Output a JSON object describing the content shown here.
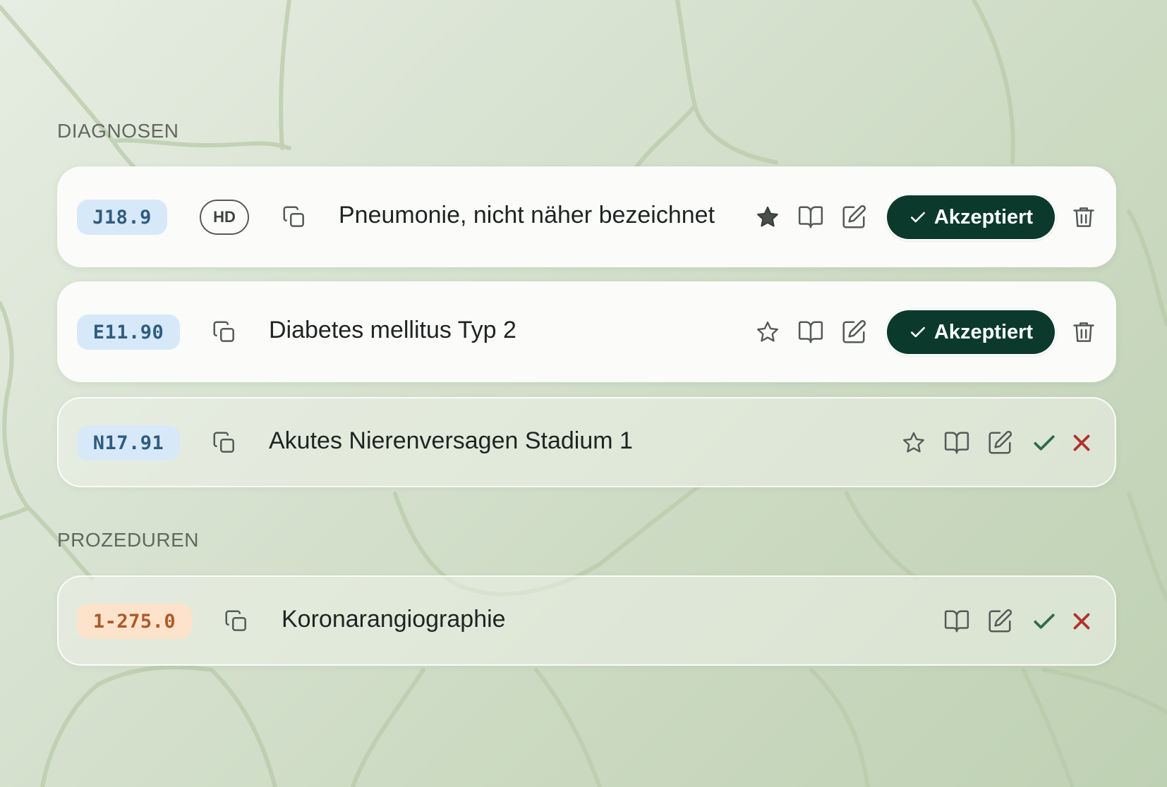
{
  "sections": {
    "diagnoses": {
      "label": "DIAGNOSEN"
    },
    "procedures": {
      "label": "PROZEDUREN"
    }
  },
  "diagnoses": [
    {
      "code": "J18.9",
      "badge": "HD",
      "description": "Pneumonie, nicht näher bezeichnet",
      "favorite": true,
      "status": "accepted",
      "status_label": "Akzeptiert"
    },
    {
      "code": "E11.90",
      "description": "Diabetes mellitus Typ 2",
      "favorite": false,
      "status": "accepted",
      "status_label": "Akzeptiert"
    },
    {
      "code": "N17.91",
      "description": "Akutes Nierenversagen Stadium 1",
      "favorite": false,
      "status": "pending"
    }
  ],
  "procedures": [
    {
      "code": "1-275.0",
      "description": "Koronarangiographie",
      "status": "pending"
    }
  ],
  "icons": {
    "copy": "copy-icon",
    "star": "star-icon",
    "book": "book-icon",
    "edit": "edit-icon",
    "trash": "trash-icon",
    "check": "check-icon",
    "close": "close-icon"
  },
  "colors": {
    "accent_dark_green": "#0b3a2c",
    "icd_badge_bg": "#d7e9f8",
    "icd_badge_text": "#2f5c82",
    "ops_badge_bg": "#fde3cc",
    "ops_badge_text": "#ad5a28",
    "accept_green": "#2f6b4f",
    "reject_red": "#b2322c"
  }
}
